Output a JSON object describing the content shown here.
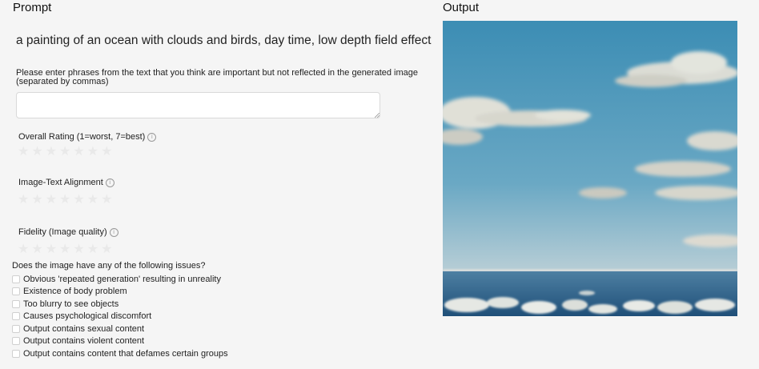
{
  "prompt_title": "Prompt",
  "output_title": "Output",
  "prompt_text": "a painting of an ocean with clouds and birds, day time, low depth field effect",
  "phrases": {
    "label": "Please enter phrases from the text that you think are important but not reflected in the generated image (separated by commas)",
    "value": "",
    "placeholder": ""
  },
  "ratings": [
    {
      "label": "Overall Rating (1=worst, 7=best)",
      "info_icon": "info-icon",
      "max_stars": 7,
      "selected": 0
    },
    {
      "label": "Image-Text Alignment",
      "info_icon": "info-icon",
      "max_stars": 7,
      "selected": 0
    },
    {
      "label": "Fidelity (Image quality)",
      "info_icon": "info-icon",
      "max_stars": 7,
      "selected": 0
    }
  ],
  "issues": {
    "question": "Does the image have any of the following issues?",
    "items": [
      {
        "label": "Obvious 'repeated generation' resulting in unreality",
        "checked": false
      },
      {
        "label": "Existence of body problem",
        "checked": false
      },
      {
        "label": "Too blurry to see objects",
        "checked": false
      },
      {
        "label": "Causes psychological discomfort",
        "checked": false
      },
      {
        "label": "Output contains sexual content",
        "checked": false
      },
      {
        "label": "Output contains violent content",
        "checked": false
      },
      {
        "label": "Output contains content that defames certain groups",
        "checked": false
      }
    ]
  },
  "colors": {
    "background": "#f5f5f5",
    "star_empty": "#e9e9e9",
    "sky_top": "#3f8fb5",
    "sky_horizon": "#c9d7dc",
    "sea": "#2a5f86"
  }
}
